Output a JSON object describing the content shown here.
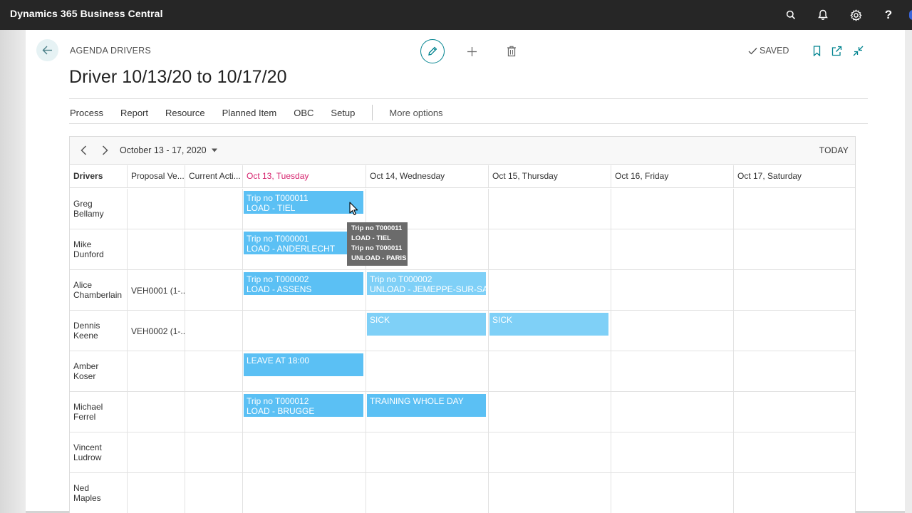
{
  "app": {
    "title": "Dynamics 365 Business Central",
    "icons": [
      "search-icon",
      "bell-icon",
      "gear-icon",
      "help-icon"
    ],
    "help_label": "?"
  },
  "header": {
    "caption": "AGENDA DRIVERS",
    "title": "Driver 10/13/20 to 10/17/20",
    "saved_label": "SAVED",
    "accent_color": "#00838f"
  },
  "menu": {
    "items": [
      "Process",
      "Report",
      "Resource",
      "Planned Item",
      "OBC",
      "Setup"
    ],
    "more_label": "More options"
  },
  "scheduler": {
    "range_label": "October 13 - 17, 2020",
    "today_label": "TODAY",
    "columns": [
      "Drivers",
      "Proposal Ve...",
      "Current Acti..."
    ],
    "days": [
      "Oct 13, Tuesday",
      "Oct 14, Wednesday",
      "Oct 15, Thursday",
      "Oct 16, Friday",
      "Oct 17, Saturday"
    ],
    "rows": [
      {
        "driver": [
          "Greg",
          "Bellamy"
        ],
        "proposal": "",
        "current": ""
      },
      {
        "driver": [
          "Mike",
          "Dunford"
        ],
        "proposal": "",
        "current": ""
      },
      {
        "driver": [
          "Alice",
          "Chamberlain"
        ],
        "proposal": "VEH0001 (1-...",
        "current": ""
      },
      {
        "driver": [
          "Dennis",
          "Keene"
        ],
        "proposal": "VEH0002 (1-...",
        "current": ""
      },
      {
        "driver": [
          "Amber",
          "Koser"
        ],
        "proposal": "",
        "current": ""
      },
      {
        "driver": [
          "Michael",
          "Ferrel"
        ],
        "proposal": "",
        "current": ""
      },
      {
        "driver": [
          "Vincent",
          "Ludrow"
        ],
        "proposal": "",
        "current": ""
      },
      {
        "driver": [
          "Ned",
          "Maples"
        ],
        "proposal": "",
        "current": ""
      }
    ],
    "events": [
      {
        "row": 0,
        "day": 0,
        "lines": [
          "Trip no T000011",
          "LOAD - TIEL",
          "Trip no T000011"
        ]
      },
      {
        "row": 1,
        "day": 0,
        "lines": [
          "Trip no T000001",
          "LOAD - ANDERLECHT",
          "Trip no T000001"
        ]
      },
      {
        "row": 2,
        "day": 0,
        "lines": [
          "Trip no T000002",
          "LOAD - ASSENS"
        ]
      },
      {
        "row": 2,
        "day": 1,
        "lines": [
          "Trip no T000002",
          "UNLOAD - JEMEPPE-SUR-SAMBRE"
        ]
      },
      {
        "row": 3,
        "day": 1,
        "lines": [
          "SICK"
        ]
      },
      {
        "row": 3,
        "day": 2,
        "lines": [
          "SICK"
        ]
      },
      {
        "row": 4,
        "day": 0,
        "lines": [
          "LEAVE AT 18:00"
        ]
      },
      {
        "row": 5,
        "day": 0,
        "lines": [
          "Trip no T000012",
          "LOAD - BRUGGE",
          "Trip no T000012"
        ]
      },
      {
        "row": 5,
        "day": 1,
        "lines": [
          "TRAINING WHOLE DAY"
        ]
      }
    ],
    "event_color": "#5bc0f4",
    "today_color": "#d6246e"
  },
  "tooltip": {
    "lines": [
      "Trip no T000011",
      "LOAD - TIEL",
      "Trip no T000011",
      "UNLOAD - PARIS"
    ]
  }
}
